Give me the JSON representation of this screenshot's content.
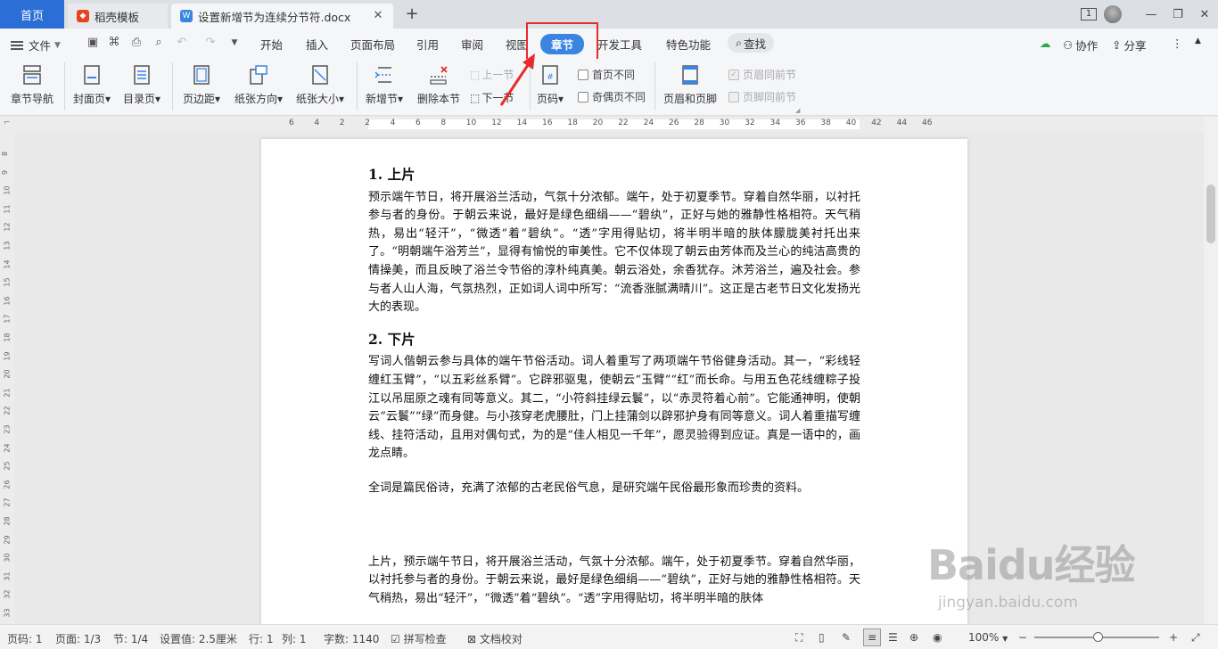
{
  "tabs": {
    "home": "首页",
    "template": "稻壳模板",
    "document": "设置新增节为连续分节符.docx",
    "window_count": "1"
  },
  "menu": {
    "file": "文件",
    "tabs": [
      "开始",
      "插入",
      "页面布局",
      "引用",
      "审阅",
      "视图",
      "章节",
      "开发工具",
      "特色功能"
    ],
    "active_tab": "章节",
    "search": "查找",
    "collab": "协作",
    "share": "分享"
  },
  "ribbon": {
    "nav": "章节导航",
    "cover": "封面页",
    "toc": "目录页",
    "margin": "页边距",
    "orientation": "纸张方向",
    "size": "纸张大小",
    "new_section": "新增节",
    "delete_section": "删除本节",
    "prev_section": "上一节",
    "next_section": "下一节",
    "page_number": "页码",
    "first_diff": "首页不同",
    "odd_even_diff": "奇偶页不同",
    "header_footer": "页眉和页脚",
    "same_header": "页眉同前节",
    "same_footer": "页脚同前节"
  },
  "ruler": {
    "h_ticks": [
      "6",
      "4",
      "2",
      "2",
      "4",
      "6",
      "8",
      "10",
      "12",
      "14",
      "16",
      "18",
      "20",
      "22",
      "24",
      "26",
      "28",
      "30",
      "32",
      "34",
      "36",
      "38",
      "40",
      "42",
      "44",
      "46"
    ],
    "v_ticks": [
      "8",
      "9",
      "10",
      "11",
      "12",
      "13",
      "14",
      "15",
      "16",
      "17",
      "18",
      "19",
      "20",
      "21",
      "22",
      "23",
      "24",
      "25",
      "26",
      "27",
      "28",
      "29",
      "30",
      "31",
      "32",
      "33"
    ]
  },
  "document": {
    "heading1": "1.  上片",
    "para1": "预示端午节日，将开展浴兰活动，气氛十分浓郁。端午，处于初夏季节。穿着自然华丽，以衬托参与者的身份。于朝云来说，最好是绿色细绢——“碧纨”，正好与她的雅静性格相符。天气稍热，易出“轻汗”，“微透”着“碧纨”。“透”字用得贴切，将半明半暗的肤体朦胧美衬托出来了。“明朝端午浴芳兰”，显得有愉悦的审美性。它不仅体现了朝云由芳体而及兰心的纯洁高贵的情操美，而且反映了浴兰令节俗的淳朴纯真美。朝云浴处，余香犹存。沐芳浴兰，遍及社会。参与者人山人海，气氛热烈，正如词人词中所写：“流香涨腻满晴川”。这正是古老节日文化发扬光大的表现。",
    "heading2": "2.  下片",
    "para2": "写词人偕朝云参与具体的端午节俗活动。词人着重写了两项端午节俗健身活动。其一，“彩线轻缠红玉臂”，“以五彩丝系臂”。它辟邪驱鬼，使朝云“玉臂”“红”而长命。与用五色花线缠粽子投江以吊屈原之魂有同等意义。其二，“小符斜挂绿云鬟”，以“赤灵符着心前”。它能通神明，使朝云“云鬟”“绿”而身健。与小孩穿老虎腰肚，门上挂蒲剑以辟邪护身有同等意义。词人着重描写缠线、挂符活动，且用对偶句式，为的是“佳人相见一千年”，愿灵验得到应证。真是一语中的，画龙点睛。",
    "para3": "全词是篇民俗诗，充满了浓郁的古老民俗气息，是研究端午民俗最形象而珍贵的资料。",
    "para4": "上片，预示端午节日，将开展浴兰活动，气氛十分浓郁。端午，处于初夏季节。穿着自然华丽，以衬托参与者的身份。于朝云来说，最好是绿色细绢——“碧纨”，正好与她的雅静性格相符。天气稍热，易出“轻汗”，“微透”着“碧纨”。“透”字用得贴切，将半明半暗的肤体"
  },
  "status": {
    "page_num": "页码: 1",
    "pages": "页面: 1/3",
    "section": "节: 1/4",
    "setting": "设置值: 2.5厘米",
    "row": "行: 1",
    "col": "列: 1",
    "words": "字数: 1140",
    "spell": "拼写检查",
    "proof": "文档校对",
    "zoom": "100%"
  },
  "watermark": {
    "brand": "Baidu经验",
    "url": "jingyan.baidu.com"
  },
  "colors": {
    "accent": "#3a85e0",
    "highlight": "#e82b2b",
    "home_tab": "#2b6fd6"
  }
}
